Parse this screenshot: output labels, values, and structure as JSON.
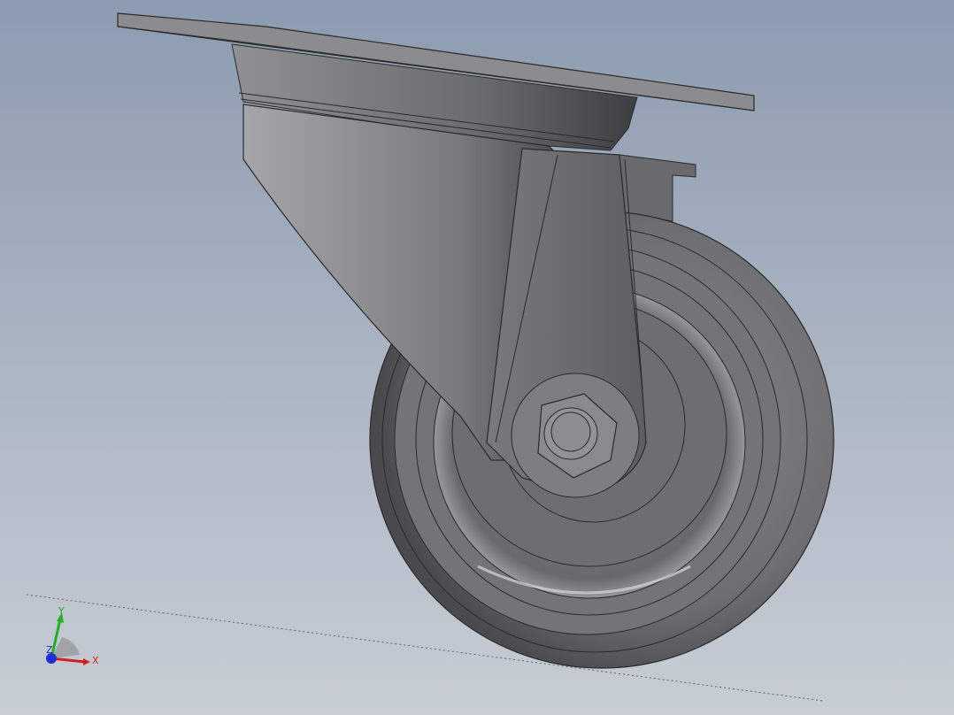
{
  "viewport": {
    "background_top": "#8e9db0",
    "background_bottom": "#c6ccd4"
  },
  "model": {
    "body_color": "#8a8a8a",
    "edge_color": "#2a2a2a"
  },
  "triad": {
    "x_label": "X",
    "y_label": "Y",
    "z_label": "Z",
    "x_color": "#d42020",
    "y_color": "#20b020",
    "z_color": "#2030d0"
  }
}
